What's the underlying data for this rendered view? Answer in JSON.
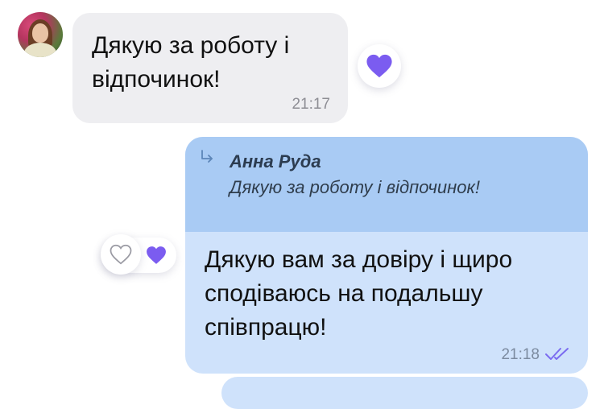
{
  "colors": {
    "incoming_bubble": "#eeeef1",
    "outgoing_bubble": "#cfe2fb",
    "quote_background": "#a9cbf4",
    "heart_purple": "#7b5cf0",
    "read_ticks": "#7b6cf0"
  },
  "incoming_message": {
    "text": "Дякую за роботу і відпочинок!",
    "time": "21:17",
    "reaction_icon": "heart-icon"
  },
  "outgoing_message": {
    "quote": {
      "author": "Анна Руда",
      "text": "Дякую за роботу і відпочинок!"
    },
    "text": "Дякую вам за довіру і щиро сподіваюсь на подальшу співпрацю!",
    "time": "21:18",
    "status_icon": "double-check-icon",
    "reactions": [
      "heart-outline-icon",
      "heart-icon"
    ]
  }
}
